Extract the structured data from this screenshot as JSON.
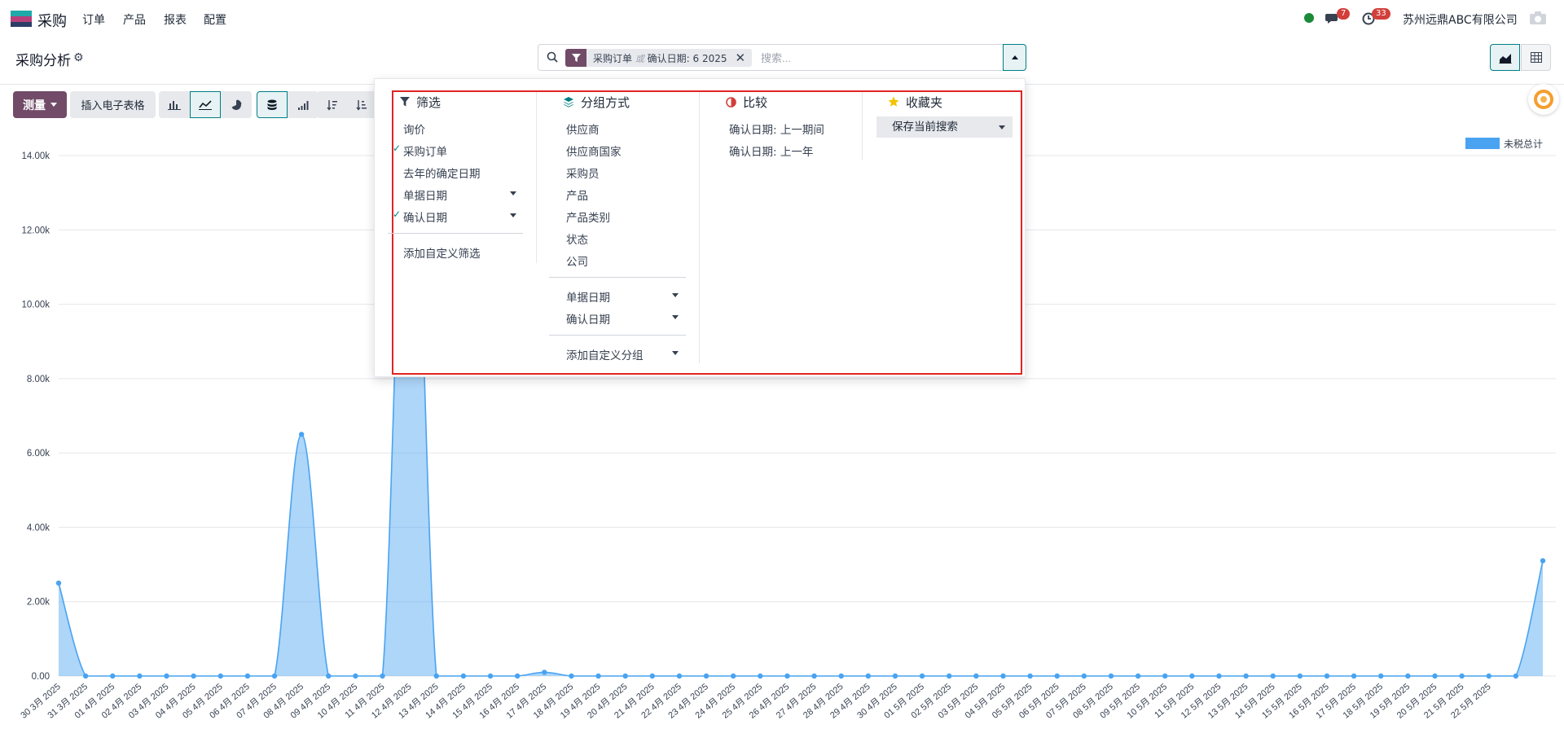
{
  "app": {
    "name": "采购"
  },
  "menu": [
    "订单",
    "产品",
    "报表",
    "配置"
  ],
  "systray": {
    "messages_count": "7",
    "activities_count": "33",
    "company": "苏州远鼎ABC有限公司"
  },
  "control_panel": {
    "title": "采购分析",
    "search": {
      "facet_values": [
        "采购订单",
        "确认日期: 6 2025"
      ],
      "facet_separator": "或",
      "placeholder": "搜索..."
    }
  },
  "toolbar": {
    "measure_label": "测量",
    "insert_label": "插入电子表格"
  },
  "dropdown": {
    "filters": {
      "title": "筛选",
      "items": [
        {
          "label": "询价",
          "checked": false
        },
        {
          "label": "采购订单",
          "checked": true
        },
        {
          "label": "去年的确定日期",
          "checked": false
        },
        {
          "label": "单据日期",
          "checked": false,
          "submenu": true
        },
        {
          "label": "确认日期",
          "checked": true,
          "submenu": true
        }
      ],
      "add_custom": "添加自定义筛选"
    },
    "group_by": {
      "title": "分组方式",
      "items": [
        "供应商",
        "供应商国家",
        "采购员",
        "产品",
        "产品类别",
        "状态",
        "公司"
      ],
      "date_items": [
        "单据日期",
        "确认日期"
      ],
      "add_custom": "添加自定义分组"
    },
    "comparison": {
      "title": "比较",
      "items": [
        "确认日期: 上一期间",
        "确认日期: 上一年"
      ]
    },
    "favorites": {
      "title": "收藏夹",
      "save_current": "保存当前搜索"
    }
  },
  "colors": {
    "brand": "#714b67",
    "accent": "#017e84",
    "series": "#4aa3f1",
    "highlight": "#e02424"
  },
  "chart_data": {
    "type": "area",
    "series": [
      {
        "name": "未税总计",
        "values": [
          2500,
          0,
          0,
          0,
          0,
          0,
          0,
          0,
          0,
          6500,
          0,
          0,
          0,
          16500,
          0,
          0,
          0,
          0,
          100,
          0,
          0,
          0,
          0,
          0,
          0,
          0,
          0,
          0,
          0,
          0,
          0,
          0,
          0,
          0,
          0,
          0,
          0,
          0,
          0,
          0,
          0,
          0,
          0,
          0,
          0,
          0,
          0,
          0,
          0,
          0,
          0,
          0,
          0,
          0,
          0,
          3100
        ]
      }
    ],
    "categories": [
      "30 3月 2025",
      "31 3月 2025",
      "01 4月 2025",
      "02 4月 2025",
      "03 4月 2025",
      "04 4月 2025",
      "05 4月 2025",
      "06 4月 2025",
      "07 4月 2025",
      "08 4月 2025",
      "09 4月 2025",
      "10 4月 2025",
      "11 4月 2025",
      "12 4月 2025",
      "13 4月 2025",
      "14 4月 2025",
      "15 4月 2025",
      "16 4月 2025",
      "17 4月 2025",
      "18 4月 2025",
      "19 4月 2025",
      "20 4月 2025",
      "21 4月 2025",
      "22 4月 2025",
      "23 4月 2025",
      "24 4月 2025",
      "25 4月 2025",
      "26 4月 2025",
      "27 4月 2025",
      "28 4月 2025",
      "29 4月 2025",
      "30 4月 2025",
      "01 5月 2025",
      "02 5月 2025",
      "03 5月 2025",
      "04 5月 2025",
      "05 5月 2025",
      "06 5月 2025",
      "07 5月 2025",
      "08 5月 2025",
      "09 5月 2025",
      "10 5月 2025",
      "11 5月 2025",
      "12 5月 2025",
      "13 5月 2025",
      "14 5月 2025",
      "15 5月 2025",
      "16 5月 2025",
      "17 5月 2025",
      "18 5月 2025",
      "19 5月 2025",
      "20 5月 2025",
      "21 5月 2025",
      "22 5月 2025"
    ],
    "y_ticks": [
      "0.00",
      "2.00k",
      "4.00k",
      "6.00k",
      "8.00k",
      "10.00k",
      "12.00k",
      "14.00k"
    ],
    "ylim": [
      0,
      14000
    ],
    "grid": true,
    "legend": "top-right"
  }
}
